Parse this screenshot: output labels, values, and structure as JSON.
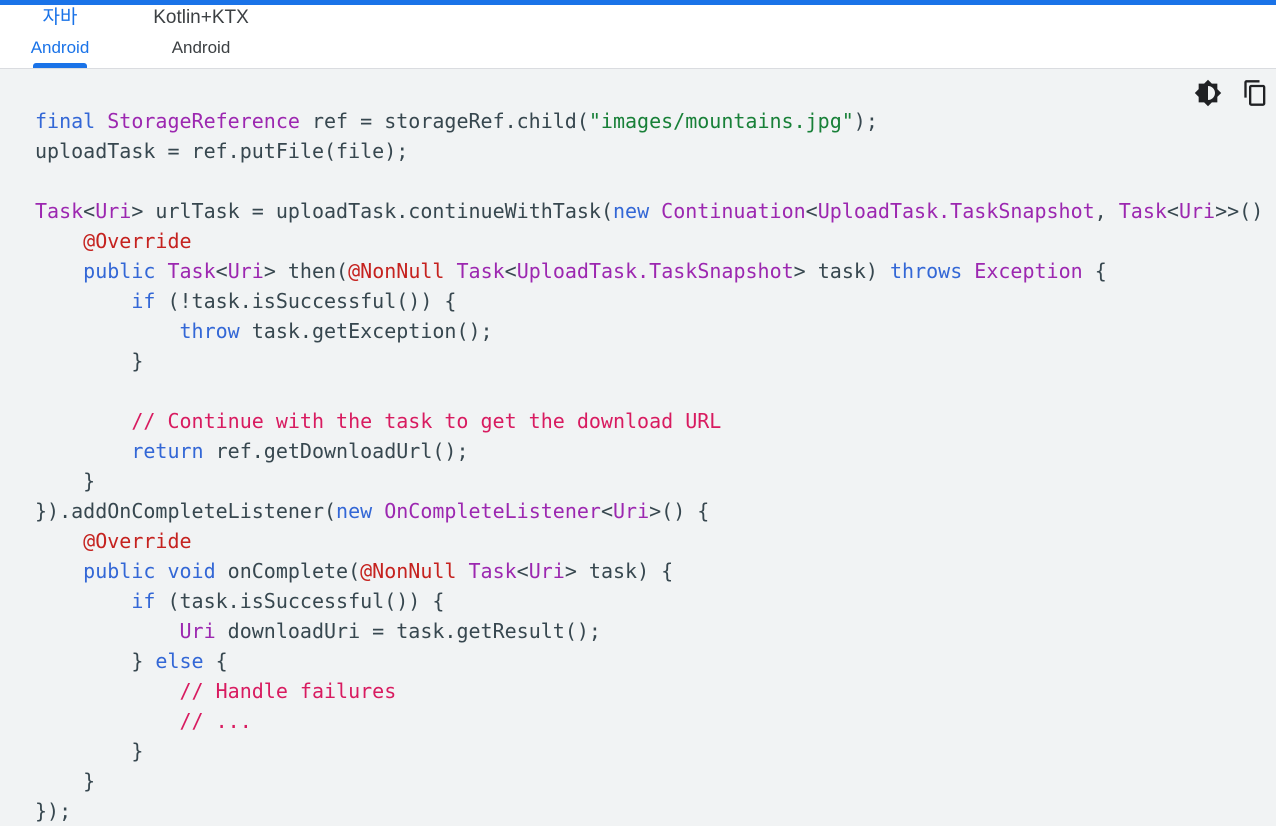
{
  "tabs": [
    {
      "title": "자바",
      "subtitle": "Android",
      "active": true
    },
    {
      "title": "Kotlin+KTX",
      "subtitle": "Android",
      "active": false
    }
  ],
  "toolbar": {
    "theme_icon": "dark-theme-toggle-icon",
    "copy_icon": "copy-icon"
  },
  "colors": {
    "accent": "#1a73e8",
    "keyword": "#3367d6",
    "type": "#9c27b0",
    "annotation": "#c5221f",
    "string": "#188038",
    "comment": "#d81b60",
    "plain": "#37474f",
    "code_background": "#f1f3f4"
  },
  "code": {
    "language": "java",
    "lines": [
      [
        [
          "kw",
          "final "
        ],
        [
          "ty",
          "StorageReference"
        ],
        [
          "pl",
          " ref = storageRef.child("
        ],
        [
          "st",
          "\"images/mountains.jpg\""
        ],
        [
          "pl",
          ");"
        ]
      ],
      [
        [
          "pl",
          "uploadTask = ref.putFile(file);"
        ]
      ],
      [],
      [
        [
          "ty",
          "Task"
        ],
        [
          "pl",
          "<"
        ],
        [
          "ty",
          "Uri"
        ],
        [
          "pl",
          "> urlTask = uploadTask.continueWithTask("
        ],
        [
          "kw",
          "new "
        ],
        [
          "ty",
          "Continuation"
        ],
        [
          "pl",
          "<"
        ],
        [
          "ty",
          "UploadTask.TaskSnapshot"
        ],
        [
          "pl",
          ", "
        ],
        [
          "ty",
          "Task"
        ],
        [
          "pl",
          "<"
        ],
        [
          "ty",
          "Uri"
        ],
        [
          "pl",
          ">>() {"
        ]
      ],
      [
        [
          "pl",
          "    "
        ],
        [
          "an",
          "@Override"
        ]
      ],
      [
        [
          "pl",
          "    "
        ],
        [
          "kw",
          "public "
        ],
        [
          "ty",
          "Task"
        ],
        [
          "pl",
          "<"
        ],
        [
          "ty",
          "Uri"
        ],
        [
          "pl",
          "> then("
        ],
        [
          "an",
          "@NonNull "
        ],
        [
          "ty",
          "Task"
        ],
        [
          "pl",
          "<"
        ],
        [
          "ty",
          "UploadTask.TaskSnapshot"
        ],
        [
          "pl",
          "> task) "
        ],
        [
          "kw",
          "throws "
        ],
        [
          "ty",
          "Exception"
        ],
        [
          "pl",
          " {"
        ]
      ],
      [
        [
          "pl",
          "        "
        ],
        [
          "kw",
          "if"
        ],
        [
          "pl",
          " (!task.isSuccessful()) {"
        ]
      ],
      [
        [
          "pl",
          "            "
        ],
        [
          "kw",
          "throw"
        ],
        [
          "pl",
          " task.getException();"
        ]
      ],
      [
        [
          "pl",
          "        }"
        ]
      ],
      [],
      [
        [
          "pl",
          "        "
        ],
        [
          "cm",
          "// Continue with the task to get the download URL"
        ]
      ],
      [
        [
          "pl",
          "        "
        ],
        [
          "kw",
          "return"
        ],
        [
          "pl",
          " ref.getDownloadUrl();"
        ]
      ],
      [
        [
          "pl",
          "    }"
        ]
      ],
      [
        [
          "pl",
          "}).addOnCompleteListener("
        ],
        [
          "kw",
          "new "
        ],
        [
          "ty",
          "OnCompleteListener"
        ],
        [
          "pl",
          "<"
        ],
        [
          "ty",
          "Uri"
        ],
        [
          "pl",
          ">() {"
        ]
      ],
      [
        [
          "pl",
          "    "
        ],
        [
          "an",
          "@Override"
        ]
      ],
      [
        [
          "pl",
          "    "
        ],
        [
          "kw",
          "public void"
        ],
        [
          "pl",
          " onComplete("
        ],
        [
          "an",
          "@NonNull "
        ],
        [
          "ty",
          "Task"
        ],
        [
          "pl",
          "<"
        ],
        [
          "ty",
          "Uri"
        ],
        [
          "pl",
          "> task) {"
        ]
      ],
      [
        [
          "pl",
          "        "
        ],
        [
          "kw",
          "if"
        ],
        [
          "pl",
          " (task.isSuccessful()) {"
        ]
      ],
      [
        [
          "pl",
          "            "
        ],
        [
          "ty",
          "Uri"
        ],
        [
          "pl",
          " downloadUri = task.getResult();"
        ]
      ],
      [
        [
          "pl",
          "        } "
        ],
        [
          "kw",
          "else"
        ],
        [
          "pl",
          " {"
        ]
      ],
      [
        [
          "pl",
          "            "
        ],
        [
          "cm",
          "// Handle failures"
        ]
      ],
      [
        [
          "pl",
          "            "
        ],
        [
          "cm",
          "// ..."
        ]
      ],
      [
        [
          "pl",
          "        }"
        ]
      ],
      [
        [
          "pl",
          "    }"
        ]
      ],
      [
        [
          "pl",
          "});"
        ]
      ]
    ]
  }
}
